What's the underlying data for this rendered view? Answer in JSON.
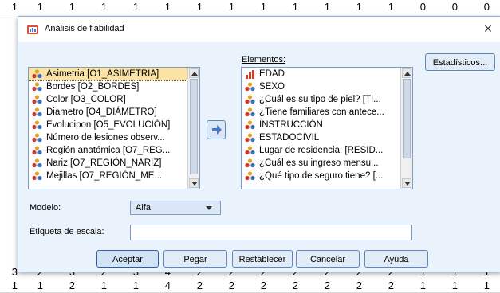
{
  "sheet": {
    "top_row": [
      "1",
      "1",
      "1",
      "1",
      "1",
      "1",
      "1",
      "1",
      "1",
      "1",
      "1",
      "1",
      "1",
      "0",
      "0",
      "0"
    ],
    "row2": [
      "3",
      "2",
      "3",
      "2",
      "3",
      "4",
      "2",
      "2",
      "2",
      "2",
      "2",
      "2",
      "2",
      "1",
      "1",
      "1"
    ],
    "row3": [
      "1",
      "1",
      "2",
      "1",
      "1",
      "4",
      "2",
      "2",
      "2",
      "2",
      "2",
      "2",
      "2",
      "1",
      "1",
      "1"
    ]
  },
  "dialog": {
    "title": "Análisis de fiabilidad",
    "close_glyph": "×",
    "elementos_label": "Elementos:",
    "estadisticos_button": "Estadísticos...",
    "source_items": [
      "Asimetria [O1_ASIMETRIA]",
      "Bordes [O2_BORDES]",
      "Color [O3_COLOR]",
      "Diametro [O4_DIÁMETRO]",
      "Evolucipon [O5_EVOLUCIÓN]",
      "Número de lesiones observ...",
      "Región anatómica [O7_REG...",
      "Nariz [O7_REGIÓN_NARIZ]",
      "Mejillas [O7_REGIÓN_ME..."
    ],
    "elementos_items": [
      {
        "label": "EDAD",
        "icon": "scale"
      },
      {
        "label": "SEXO",
        "icon": "nominal"
      },
      {
        "label": "¿Cuál es su tipo de piel? [TI...",
        "icon": "nominal"
      },
      {
        "label": "¿Tiene familiares con antece...",
        "icon": "nominal"
      },
      {
        "label": "INSTRUCCIÓN",
        "icon": "nominal"
      },
      {
        "label": "ESTADOCIVIL",
        "icon": "nominal"
      },
      {
        "label": "Lugar de residencia: [RESID...",
        "icon": "nominal"
      },
      {
        "label": "¿Cuál es su ingreso mensu...",
        "icon": "nominal"
      },
      {
        "label": "¿Qué tipo de seguro tiene? [...",
        "icon": "nominal"
      }
    ],
    "modelo_label": "Modelo:",
    "modelo_value": "Alfa",
    "etiqueta_label": "Etiqueta de escala:",
    "etiqueta_value": "",
    "buttons": {
      "aceptar": "Aceptar",
      "pegar": "Pegar",
      "restablecer": "Restablecer",
      "cancelar": "Cancelar",
      "ayuda": "Ayuda"
    }
  },
  "colors": {
    "dialog_bg": "#eaf2fb",
    "selection": "#fbe3a6",
    "border": "#7a9cc7"
  }
}
